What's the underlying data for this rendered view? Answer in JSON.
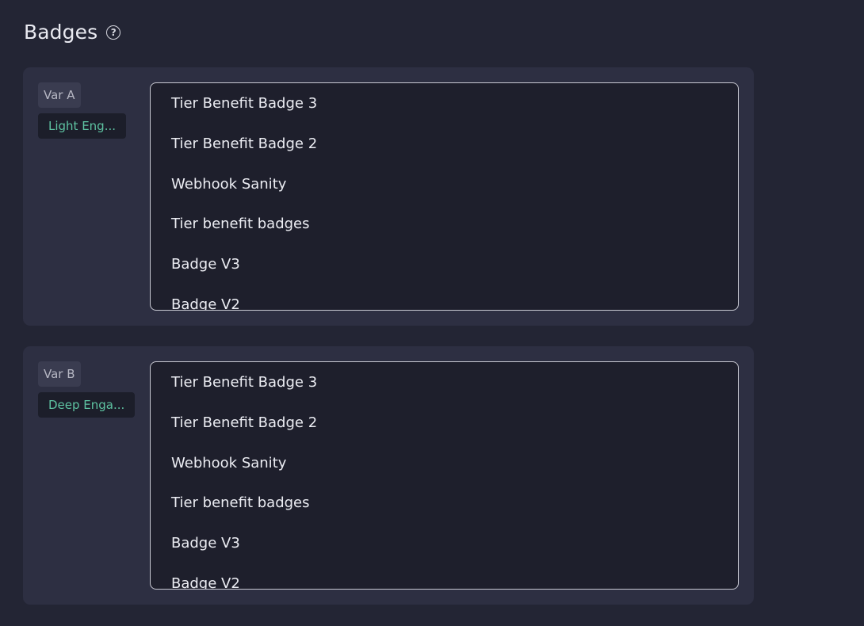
{
  "section": {
    "title": "Badges",
    "help_icon": "question-circle-icon"
  },
  "variants": [
    {
      "label": "Var A",
      "segment": "Light Eng...",
      "badges": [
        "Tier Benefit Badge 3",
        "Tier Benefit Badge 2",
        "Webhook Sanity",
        "Tier benefit badges",
        "Badge V3",
        "Badge V2"
      ]
    },
    {
      "label": "Var B",
      "segment": "Deep Enga...",
      "badges": [
        "Tier Benefit Badge 3",
        "Tier Benefit Badge 2",
        "Webhook Sanity",
        "Tier benefit badges",
        "Badge V3",
        "Badge V2"
      ]
    }
  ],
  "colors": {
    "background": "#232534",
    "card": "#2d2f42",
    "segment_text": "#5ec3a2"
  }
}
